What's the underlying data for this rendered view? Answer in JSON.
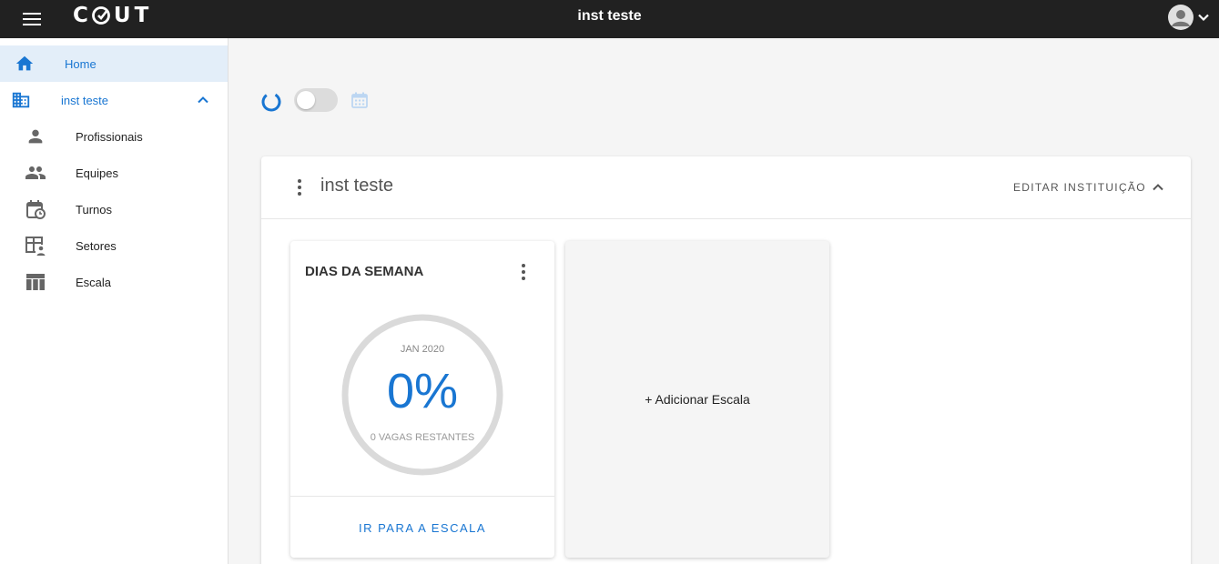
{
  "header": {
    "menu_icon": "menu-icon",
    "logo_text": "CQUT",
    "title": "inst teste",
    "avatar_icon": "account-circle-icon",
    "dropdown_icon": "chevron-down-icon"
  },
  "sidebar": {
    "home": {
      "label": "Home",
      "icon": "home-icon"
    },
    "institution": {
      "label": "inst teste",
      "icon": "building-icon",
      "toggle_icon": "chevron-up-icon"
    },
    "items": [
      {
        "label": "Profissionais",
        "icon": "person-icon"
      },
      {
        "label": "Equipes",
        "icon": "people-icon"
      },
      {
        "label": "Turnos",
        "icon": "calendar-clock-icon"
      },
      {
        "label": "Setores",
        "icon": "table-person-icon"
      },
      {
        "label": "Escala",
        "icon": "table-columns-icon"
      }
    ]
  },
  "toolbar": {
    "spinner_icon": "loading-spinner-icon",
    "toggle_on": false,
    "calendar_icon": "calendar-icon"
  },
  "panel": {
    "title": "inst teste",
    "edit_label": "EDITAR INSTITUIÇÃO",
    "collapse_icon": "chevron-up-icon"
  },
  "scale_card": {
    "title": "DIAS DA SEMANA",
    "month": "JAN 2020",
    "percent": "0%",
    "percent_value": 0,
    "remaining": "0 VAGAS RESTANTES",
    "action": "IR PARA A ESCALA"
  },
  "add_card": {
    "label": "+ Adicionar Escala"
  },
  "colors": {
    "accent": "#1976d2",
    "topbar": "#212121",
    "active_nav_bg": "#e3eef9"
  }
}
